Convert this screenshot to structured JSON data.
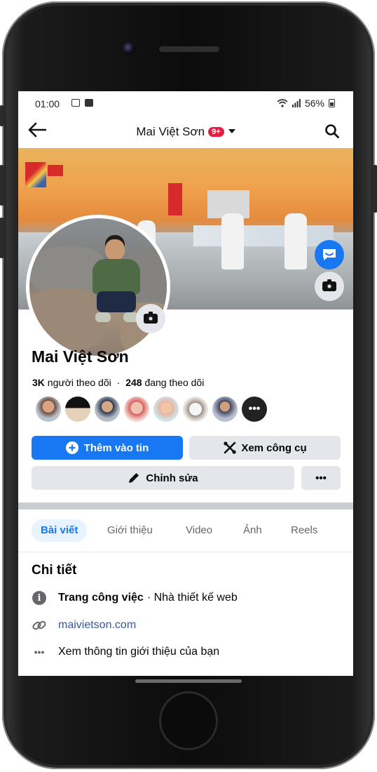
{
  "status_bar": {
    "time": "01:00",
    "battery": "56%"
  },
  "header": {
    "profile_name": "Mai Việt Sơn",
    "notification_badge": "9+"
  },
  "profile": {
    "name": "Mai Việt Sơn",
    "followers_count": "3K",
    "followers_label": "người theo dõi",
    "following_count": "248",
    "following_label": "đang theo dõi",
    "friends_more": "•••"
  },
  "actions": {
    "add_story": "Thêm vào tin",
    "view_tools": "Xem công cụ",
    "edit": "Chỉnh sửa",
    "more": "•••"
  },
  "tabs": [
    {
      "label": "Bài viết",
      "active": true
    },
    {
      "label": "Giới thiệu"
    },
    {
      "label": "Video"
    },
    {
      "label": "Ảnh"
    },
    {
      "label": "Reels"
    }
  ],
  "details": {
    "title": "Chi tiết",
    "work_page_label": "Trang công việc",
    "work_page_value": "· Nhà thiết kế web",
    "website": "maivietson.com",
    "see_about": "Xem thông tin giới thiệu của bạn"
  },
  "colors": {
    "accent": "#1877f2",
    "badge": "#e41e3f"
  }
}
